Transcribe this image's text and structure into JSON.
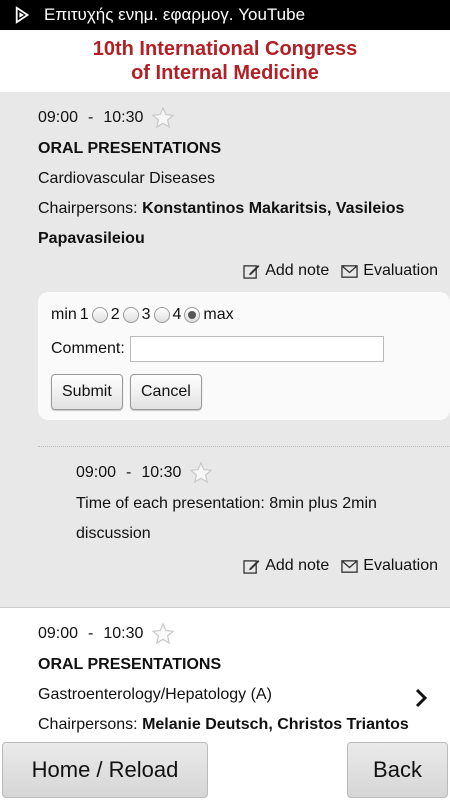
{
  "status_bar": {
    "text": "Επιτυχής ενημ. εφαρμογ. YouTube"
  },
  "header": {
    "title_line1": "10th International Congress",
    "title_line2": "of Internal Medicine",
    "color": "#b21f24"
  },
  "session1": {
    "start": "09:00",
    "sep": "-",
    "end": "10:30",
    "type": "ORAL PRESENTATIONS",
    "topic": "Cardiovascular Diseases",
    "chair_label": "Chairpersons:",
    "chair_names_1": "Konstantinos Makaritsis, Vasileios",
    "chair_names_2": "Papavasileiou",
    "add_note": "Add note",
    "evaluation": "Evaluation"
  },
  "rating": {
    "min_label": "min",
    "options": [
      "1",
      "2",
      "3",
      "4"
    ],
    "max_label": "max",
    "selected": "max",
    "comment_label": "Comment:",
    "comment_value": "",
    "submit": "Submit",
    "cancel": "Cancel"
  },
  "sub_item": {
    "start": "09:00",
    "sep": "-",
    "end": "10:30",
    "desc_line1": "Time of each presentation: 8min plus 2min",
    "desc_line2": "discussion",
    "add_note": "Add note",
    "evaluation": "Evaluation"
  },
  "session2": {
    "start": "09:00",
    "sep": "-",
    "end": "10:30",
    "type": "ORAL PRESENTATIONS",
    "topic": "Gastroenterology/Hepatology (A)",
    "chair_label": "Chairpersons:",
    "chair_names": "Melanie Deutsch, Christos Triantos"
  },
  "footer": {
    "home": "Home / Reload",
    "back": "Back"
  }
}
